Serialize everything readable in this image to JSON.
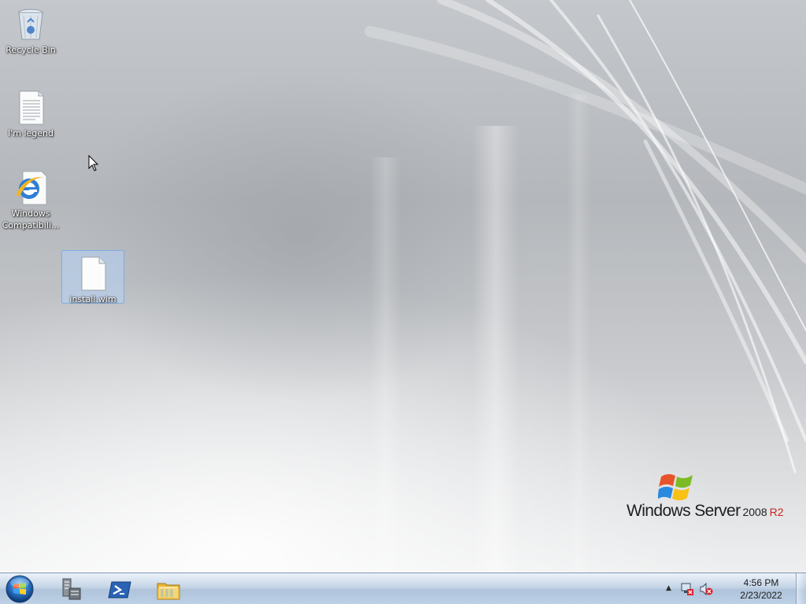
{
  "desktop": {
    "icons": [
      {
        "label": "Recycle Bin",
        "icon": "recycle-bin-icon"
      },
      {
        "label": "I'm legend",
        "icon": "text-file-icon"
      },
      {
        "label": "Windows Compatibili...",
        "icon": "internet-explorer-icon"
      },
      {
        "label": "install.wim",
        "icon": "blank-file-icon",
        "selected": true
      }
    ],
    "logo": {
      "brand": "Windows Server",
      "version": "2008",
      "edition": "R2"
    }
  },
  "taskbar": {
    "start": {
      "icon": "windows-orb-icon"
    },
    "pinned": [
      {
        "name": "server-manager",
        "icon": "server-manager-icon"
      },
      {
        "name": "powershell",
        "icon": "powershell-icon"
      },
      {
        "name": "windows-explorer",
        "icon": "folder-icon"
      }
    ],
    "tray": {
      "icons": [
        "network-error-icon",
        "speaker-muted-icon"
      ],
      "time": "4:56 PM",
      "date": "2/23/2022"
    }
  },
  "colors": {
    "accent": "#3a76c4",
    "logo_red": "#c8261e"
  }
}
